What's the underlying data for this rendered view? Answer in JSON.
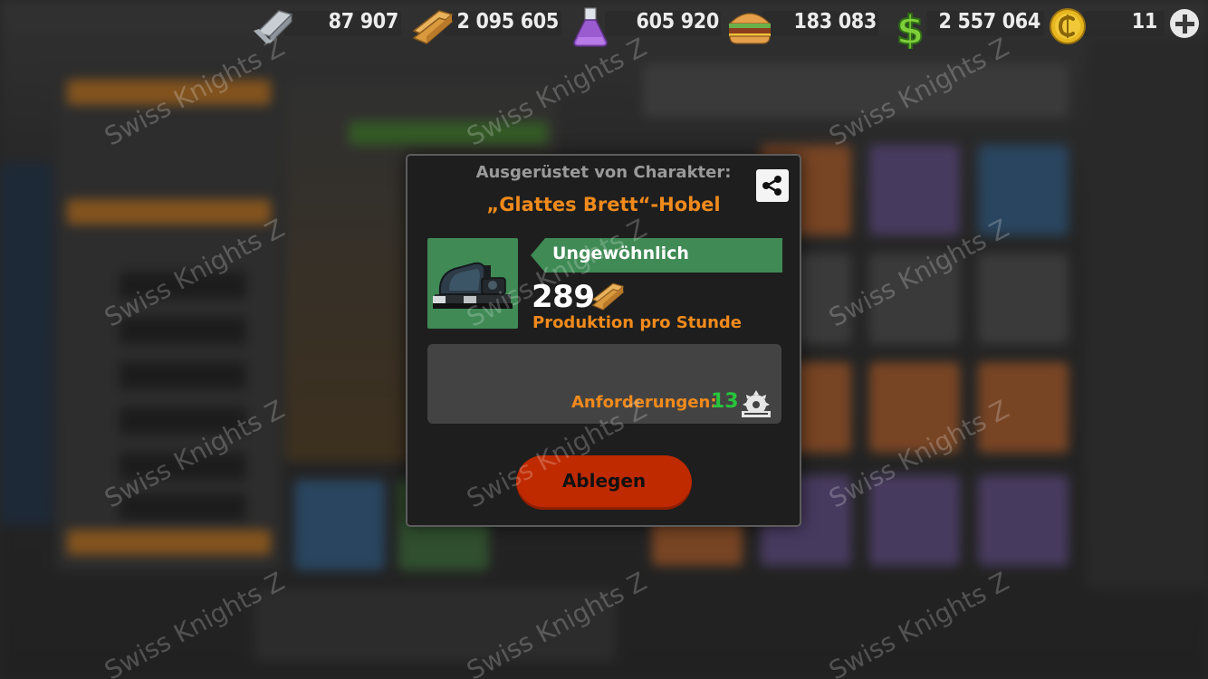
{
  "resources": [
    {
      "name": "steel",
      "icon": "steel-beam-icon",
      "value": "87 907"
    },
    {
      "name": "wood",
      "icon": "wood-planks-icon",
      "value": "2 095 605"
    },
    {
      "name": "potion",
      "icon": "potion-flask-icon",
      "value": "605 920"
    },
    {
      "name": "food",
      "icon": "burger-icon",
      "value": "183 083"
    },
    {
      "name": "cash",
      "icon": "dollar-icon",
      "value": "2 557 064"
    },
    {
      "name": "coins",
      "icon": "gold-coin-icon",
      "value": "11"
    }
  ],
  "dialog": {
    "equipped_by_label": "Ausgerüstet von Charakter:",
    "item_name": "„Glattes Brett“-Hobel",
    "rarity": "Ungewöhnlich",
    "production_value": "289",
    "production_label": "Produktion pro Stunde",
    "requirements_label": "Anforderungen:",
    "requirements_value": "13",
    "drop_button_label": "Ablegen"
  },
  "watermark": "Swiss Knights Z",
  "colors": {
    "accent_orange": "#f08a1c",
    "rarity_green": "#3f8a55",
    "requirement_green": "#28c43c",
    "drop_button": "#bf2a00",
    "dialog_bg": "#1e1e1e"
  },
  "icons": {
    "share": "share-icon",
    "plus": "plus-icon",
    "production": "wood-planks-icon",
    "requirement": "saw-blade-icon",
    "item": "electric-planer-icon"
  }
}
